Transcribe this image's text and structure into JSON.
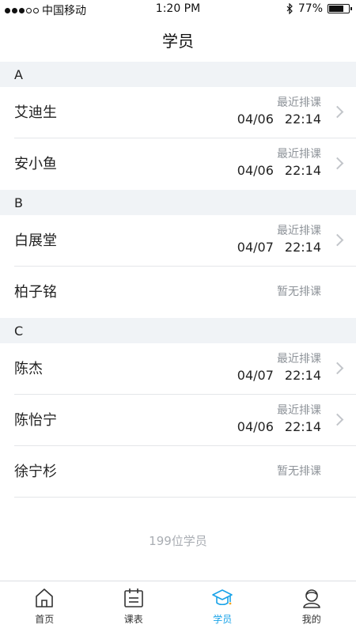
{
  "status_bar": {
    "carrier": "中国移动",
    "time": "1:20 PM",
    "battery_percent": "77%",
    "battery_level": 0.77,
    "signal_filled": 3,
    "signal_total": 5
  },
  "nav": {
    "title": "学员"
  },
  "sections": [
    {
      "letter": "A",
      "students": [
        {
          "name": "艾迪生",
          "label": "最近排课",
          "date": "04/06",
          "time": "22:14",
          "has_arrow": true
        },
        {
          "name": "安小鱼",
          "label": "最近排课",
          "date": "04/06",
          "time": "22:14",
          "has_arrow": true
        }
      ]
    },
    {
      "letter": "B",
      "students": [
        {
          "name": "白展堂",
          "label": "最近排课",
          "date": "04/07",
          "time": "22:14",
          "has_arrow": true
        },
        {
          "name": "柏子铭",
          "none_text": "暂无排课",
          "has_arrow": false
        }
      ]
    },
    {
      "letter": "C",
      "students": [
        {
          "name": "陈杰",
          "label": "最近排课",
          "date": "04/07",
          "time": "22:14",
          "has_arrow": true
        },
        {
          "name": "陈怡宁",
          "label": "最近排课",
          "date": "04/06",
          "time": "22:14",
          "has_arrow": true
        },
        {
          "name": "徐宁杉",
          "none_text": "暂无排课",
          "has_arrow": false
        }
      ]
    }
  ],
  "footer": {
    "count_text": "199位学员"
  },
  "tabbar": {
    "accent": "#1aa3e8",
    "items": [
      {
        "label": "首页",
        "icon": "home-icon",
        "active": false
      },
      {
        "label": "课表",
        "icon": "calendar-icon",
        "active": false
      },
      {
        "label": "学员",
        "icon": "graduation-cap-icon",
        "active": true
      },
      {
        "label": "我的",
        "icon": "person-icon",
        "active": false
      }
    ]
  }
}
